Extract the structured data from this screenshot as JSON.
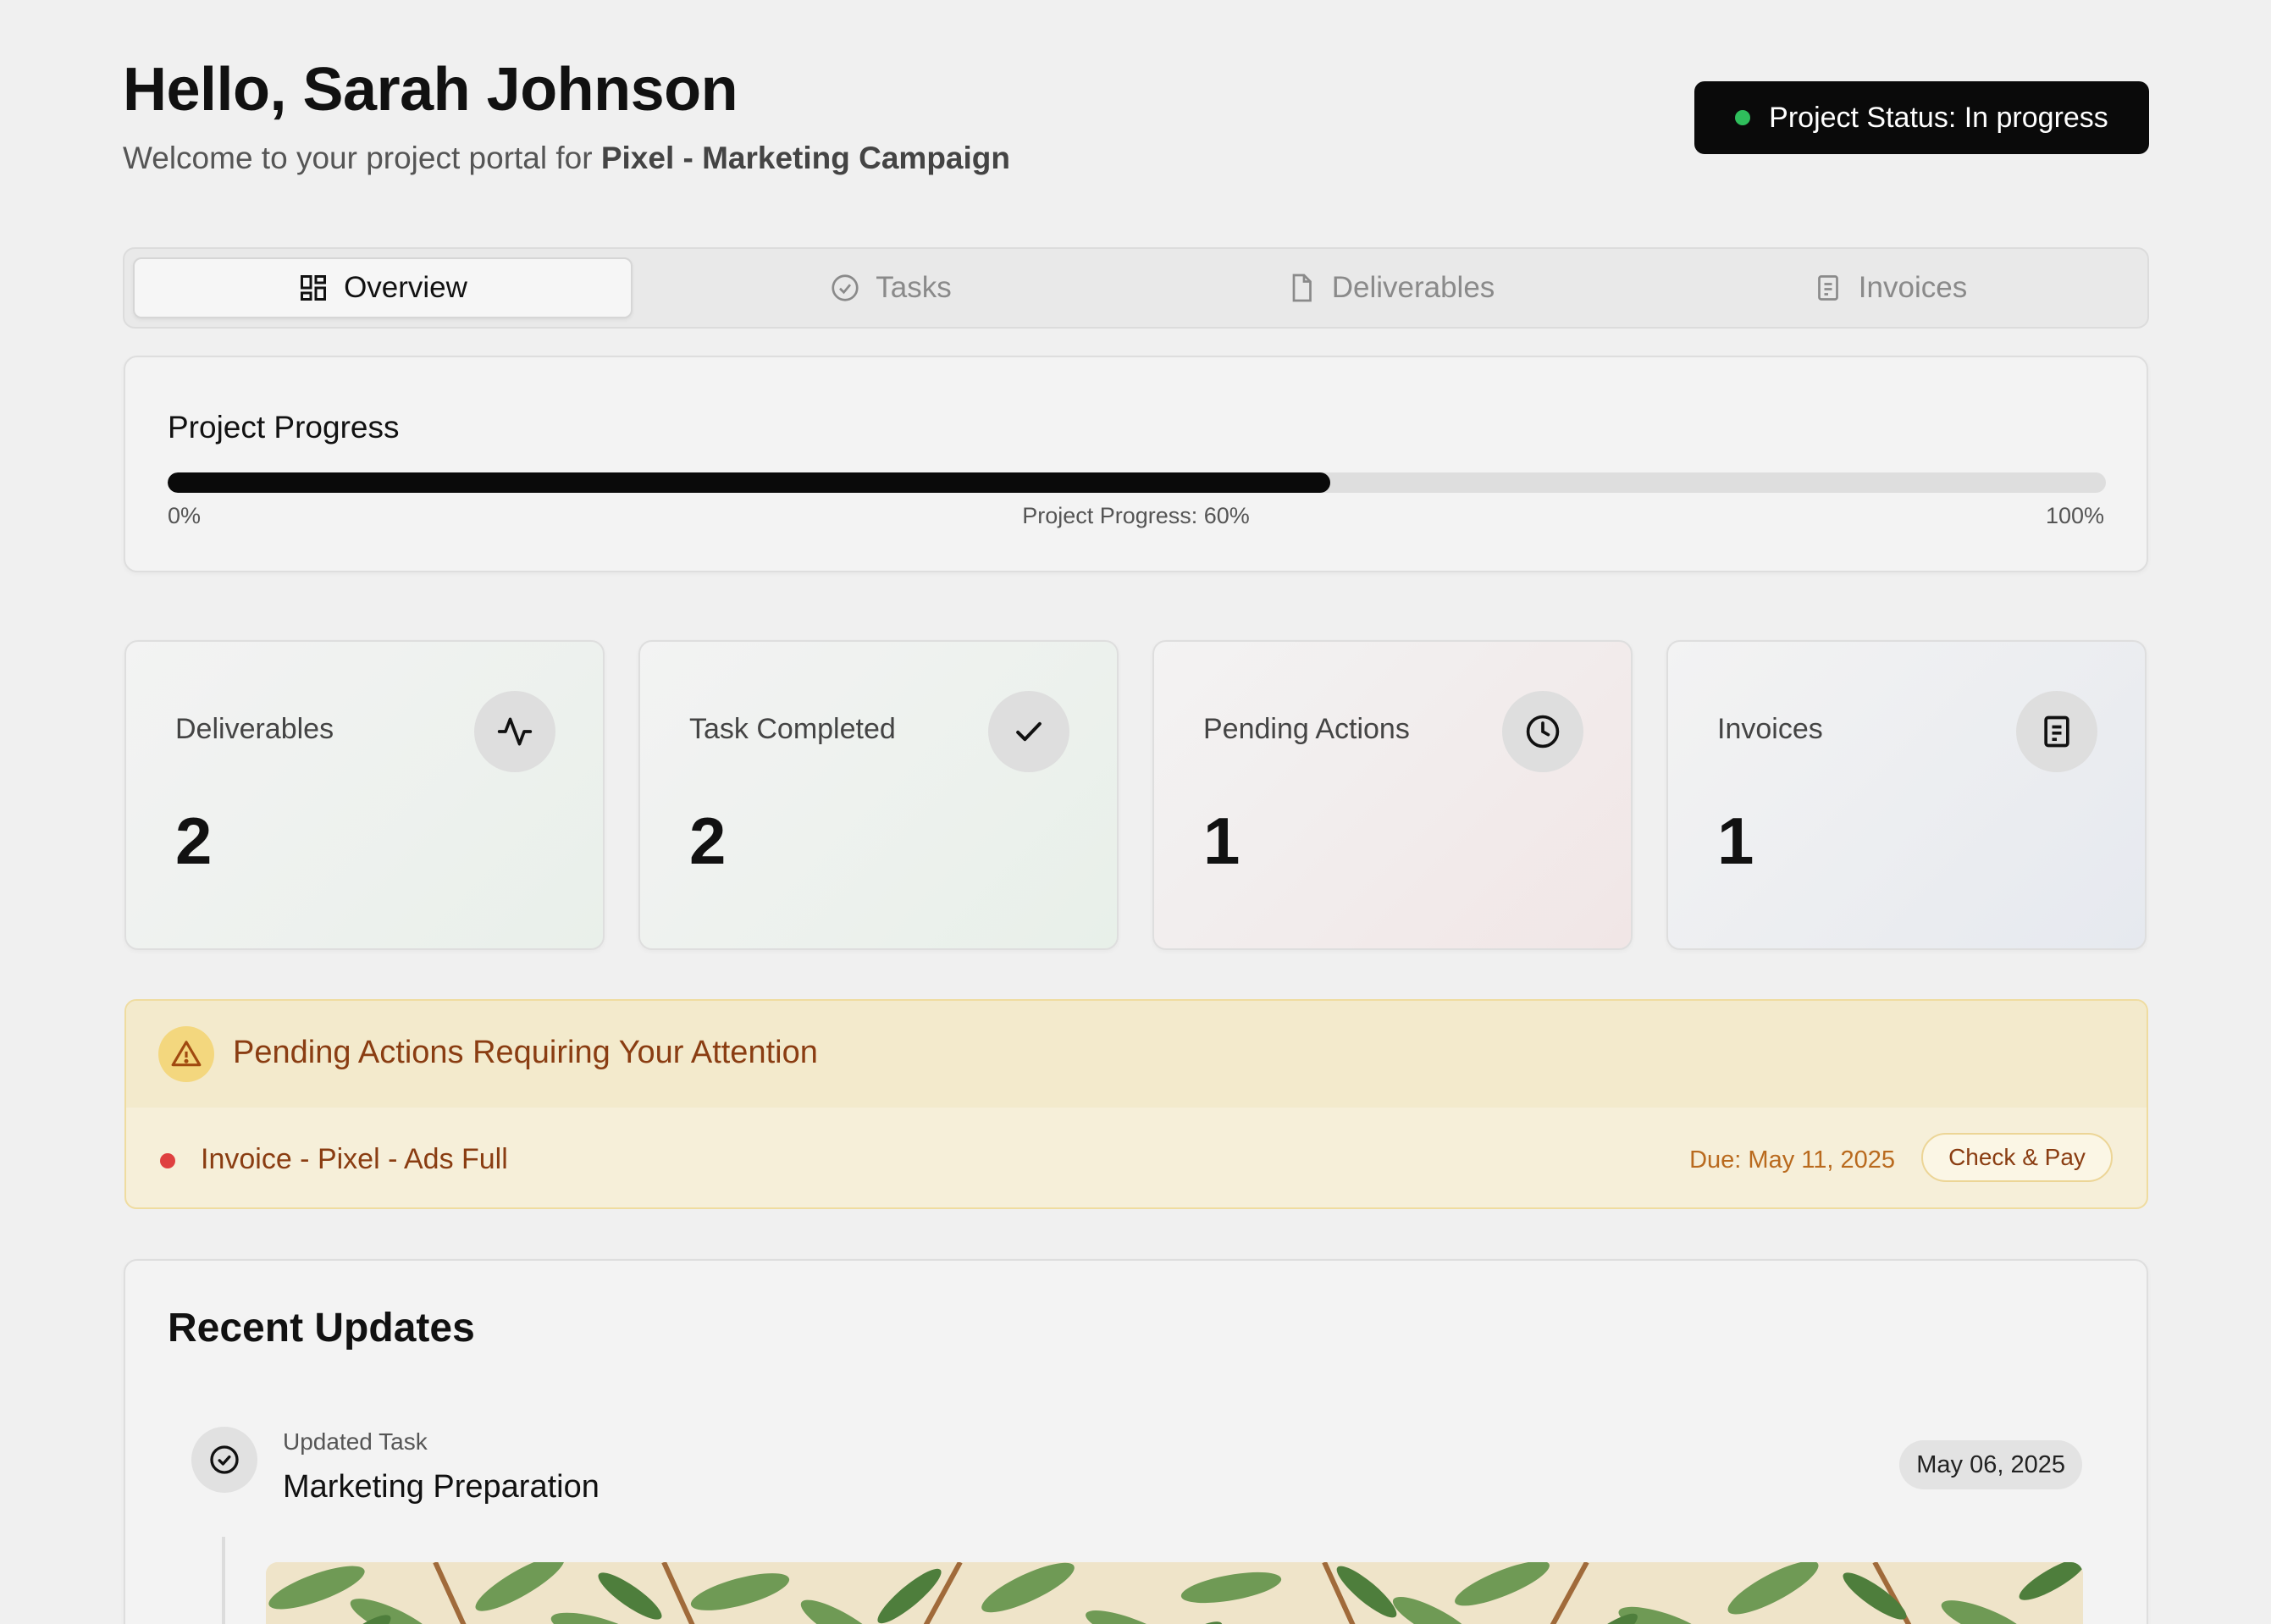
{
  "header": {
    "greeting": "Hello, Sarah Johnson",
    "subtitle_prefix": "Welcome to your project portal for ",
    "project_name": "Pixel - Marketing Campaign",
    "status_label": "Project Status: In progress"
  },
  "tabs": [
    {
      "label": "Overview",
      "icon": "grid-icon",
      "active": true
    },
    {
      "label": "Tasks",
      "icon": "check-circle-icon",
      "active": false
    },
    {
      "label": "Deliverables",
      "icon": "file-icon",
      "active": false
    },
    {
      "label": "Invoices",
      "icon": "receipt-icon",
      "active": false
    }
  ],
  "progress": {
    "title": "Project Progress",
    "value_fraction": 0.6,
    "min_label": "0%",
    "mid_label": "Project Progress: 60%",
    "max_label": "100%"
  },
  "stats": [
    {
      "label": "Deliverables",
      "value": "2",
      "icon": "activity-icon"
    },
    {
      "label": "Task Completed",
      "value": "2",
      "icon": "checkmark-icon"
    },
    {
      "label": "Pending Actions",
      "value": "1",
      "icon": "clock-icon"
    },
    {
      "label": "Invoices",
      "value": "1",
      "icon": "receipt-icon"
    }
  ],
  "pending": {
    "title": "Pending Actions Requiring Your Attention",
    "items": [
      {
        "name": "Invoice - Pixel - Ads Full",
        "due": "Due: May 11, 2025",
        "action": "Check & Pay"
      }
    ]
  },
  "updates": {
    "title": "Recent Updates",
    "items": [
      {
        "type": "Updated Task",
        "name": "Marketing Preparation",
        "date": "May 06, 2025"
      }
    ]
  },
  "colors": {
    "status_dot": "#2fbe5c",
    "warning_text": "#8a3d12",
    "alert_dot": "#df4040"
  }
}
